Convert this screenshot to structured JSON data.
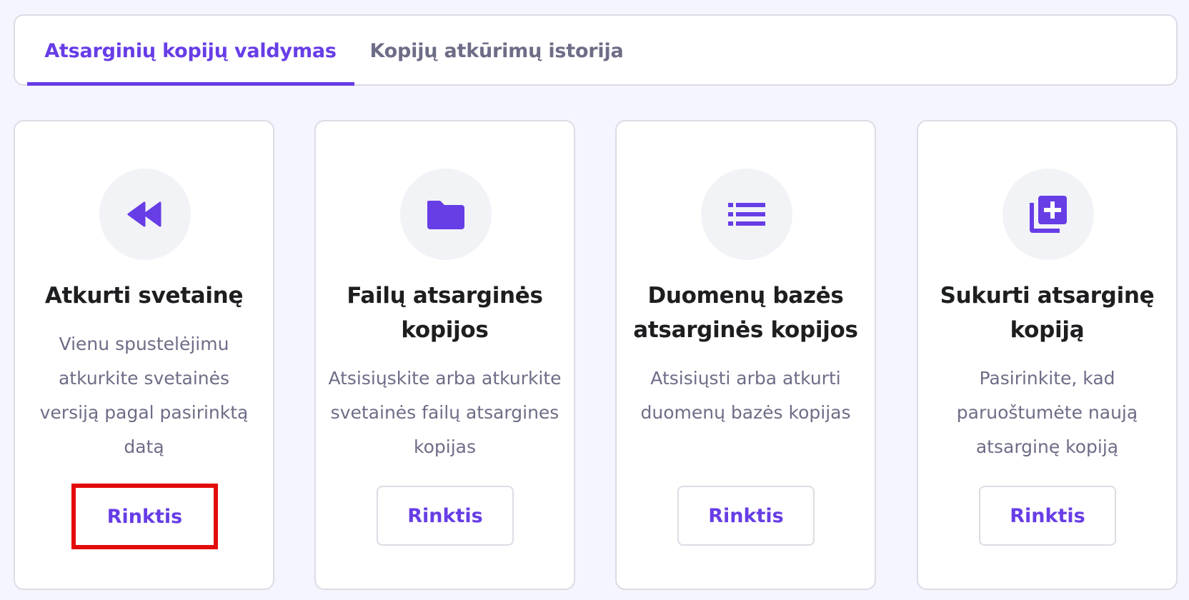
{
  "colors": {
    "accent": "#673de6",
    "highlight_border": "#e30a0a",
    "page_background": "#f4f5ff"
  },
  "tabs": [
    {
      "label": "Atsarginių kopijų valdymas",
      "active": true
    },
    {
      "label": "Kopijų atkūrimų istorija",
      "active": false
    }
  ],
  "cards": [
    {
      "icon": "rewind-icon",
      "title": "Atkurti svetainę",
      "description": "Vienu spustelėjimu atkurkite svetainės versiją pagal pasirinktą datą",
      "button_label": "Rinktis"
    },
    {
      "icon": "folder-icon",
      "title": "Failų atsarginės kopijos",
      "description": "Atsisiųskite arba atkurkite svetainės failų atsargines kopijas",
      "button_label": "Rinktis"
    },
    {
      "icon": "list-icon",
      "title": "Duomenų bazės atsarginės kopijos",
      "description": "Atsisiųsti arba atkurti duomenų bazės kopijas",
      "button_label": "Rinktis"
    },
    {
      "icon": "add-copy-icon",
      "title": "Sukurti atsarginę kopiją",
      "description": "Pasirinkite, kad paruoštumėte naują atsarginę kopiją",
      "button_label": "Rinktis"
    }
  ]
}
